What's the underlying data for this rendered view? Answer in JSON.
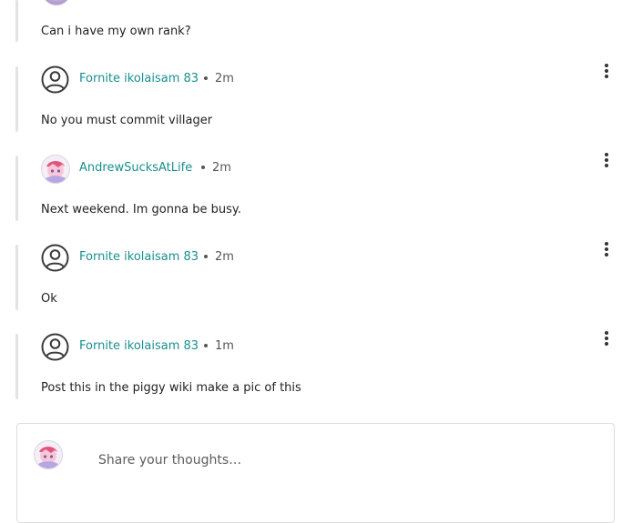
{
  "thread": {
    "first_message": "Can i have my own rank?",
    "replies": [
      {
        "author": "Fornite ikolaisam 83",
        "time": "2m",
        "text": "No you must commit villager",
        "avatar": "default-user-icon"
      },
      {
        "author": "AndrewSucksAtLife",
        "time": "2m",
        "text": "Next weekend. Im gonna be busy.",
        "avatar": "anime-avatar-image"
      },
      {
        "author": "Fornite ikolaisam 83",
        "time": "2m",
        "text": "Ok",
        "avatar": "default-user-icon"
      },
      {
        "author": "Fornite ikolaisam 83",
        "time": "1m",
        "text": "Post this in the piggy wiki make a pic of this",
        "avatar": "default-user-icon"
      }
    ]
  },
  "composer": {
    "placeholder": "Share your thoughts…",
    "value": ""
  },
  "colors": {
    "username": "#1a8f8f",
    "thread_line": "#e3e3e3"
  }
}
